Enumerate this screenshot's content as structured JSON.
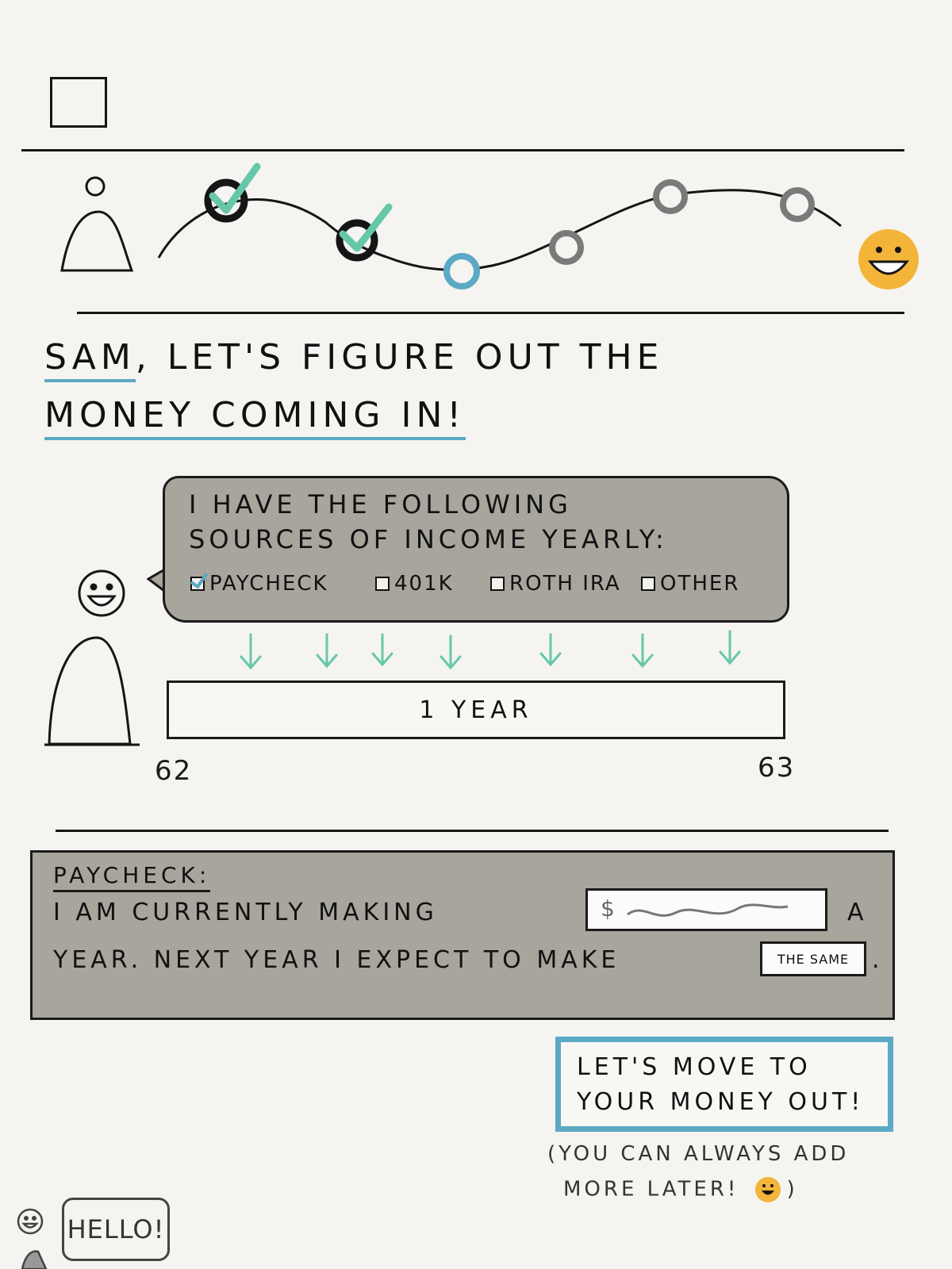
{
  "progress": {
    "steps": [
      {
        "state": "done"
      },
      {
        "state": "done"
      },
      {
        "state": "current"
      },
      {
        "state": "upcoming"
      },
      {
        "state": "upcoming"
      },
      {
        "state": "upcoming"
      }
    ],
    "goal_icon": "smiley-face-icon"
  },
  "heading": {
    "line1_name": "Sam",
    "line1_rest": ", let's figure out the",
    "line2": "money coming in!"
  },
  "income_bubble": {
    "line1": "I have the following",
    "line2": "sources of income yearly:",
    "options": [
      {
        "label": "Paycheck",
        "checked": true
      },
      {
        "label": "401k",
        "checked": false
      },
      {
        "label": "Roth IRA",
        "checked": false
      },
      {
        "label": "Other",
        "checked": false
      }
    ]
  },
  "timeline": {
    "bar_label": "1 Year",
    "start_age": "62",
    "end_age": "63"
  },
  "paycheck": {
    "title": "Paycheck:",
    "line1_a": "I am currently making",
    "salary_value": "$",
    "line1_b": "a",
    "line2_a": "year. Next year I expect to make",
    "expectation": "The same",
    "line2_end": "."
  },
  "next_button": {
    "line1": "Let's move to",
    "line2": "your money out!"
  },
  "note": {
    "line1": "(You can always add",
    "line2": "more later!",
    "close": ")"
  },
  "assistant": {
    "greeting": "Hello!"
  },
  "colors": {
    "accent_teal": "#66c8a8",
    "accent_blue": "#5ba9c4",
    "smiley_yellow": "#f2b53a",
    "panel_gray": "#a8a59d"
  }
}
